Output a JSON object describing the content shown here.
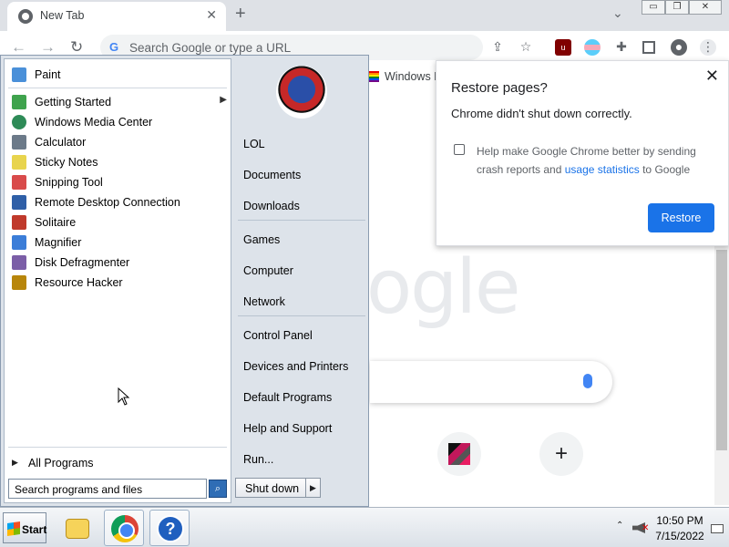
{
  "browser": {
    "tab_title": "New Tab",
    "omnibox_placeholder": "Search Google or type a URL",
    "bookmark_item": "Windows I",
    "google_logo_fragment": "ogle",
    "new_tab_symbol": "+",
    "shortcut_add_symbol": "+"
  },
  "restore_popup": {
    "title": "Restore pages?",
    "message": "Chrome didn't shut down correctly.",
    "checkbox_text_before": "Help make Google Chrome better by sending crash reports and ",
    "checkbox_link": "usage statistics",
    "checkbox_text_after": " to Google",
    "restore_button": "Restore"
  },
  "start_menu": {
    "programs": [
      {
        "label": "Paint",
        "icon": "paint-icon",
        "color": "#4a90d9"
      },
      {
        "label": "Getting Started",
        "icon": "getting-started-icon",
        "color": "#3fa34d",
        "submenu": true
      },
      {
        "label": "Windows Media Center",
        "icon": "media-center-icon",
        "color": "#2e8b57"
      },
      {
        "label": "Calculator",
        "icon": "calculator-icon",
        "color": "#6c7a89"
      },
      {
        "label": "Sticky Notes",
        "icon": "sticky-notes-icon",
        "color": "#e8d44d"
      },
      {
        "label": "Snipping Tool",
        "icon": "snipping-tool-icon",
        "color": "#d94b4b"
      },
      {
        "label": "Remote Desktop Connection",
        "icon": "remote-desktop-icon",
        "color": "#2f5fa7"
      },
      {
        "label": "Solitaire",
        "icon": "solitaire-icon",
        "color": "#c0392b"
      },
      {
        "label": "Magnifier",
        "icon": "magnifier-icon",
        "color": "#3b7dd8"
      },
      {
        "label": "Disk Defragmenter",
        "icon": "disk-defragmenter-icon",
        "color": "#7b5ea7"
      },
      {
        "label": "Resource Hacker",
        "icon": "resource-hacker-icon",
        "color": "#b8860b"
      }
    ],
    "all_programs": "All Programs",
    "search_placeholder": "Search programs and files",
    "places": [
      "LOL",
      "Documents",
      "Downloads",
      "Games",
      "Computer",
      "Network",
      "Control Panel",
      "Devices and Printers",
      "Default Programs",
      "Help and Support",
      "Run..."
    ],
    "shutdown": "Shut down"
  },
  "taskbar": {
    "start": "Start",
    "time": "10:50 PM",
    "date": "7/15/2022"
  }
}
